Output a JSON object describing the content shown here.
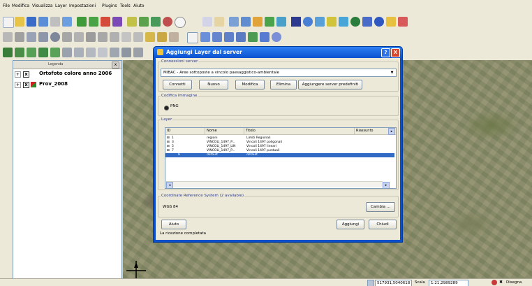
{
  "menu": [
    "File",
    "Modifica",
    "Visualizza",
    "Layer",
    "Impostazioni",
    "Plugins",
    "Tools",
    "Aiuto"
  ],
  "legend": {
    "title": "Legenda",
    "close": "x",
    "layers": [
      {
        "name": "Ortofoto colore anno 2006",
        "checked": "x"
      },
      {
        "name": "Prov_2008",
        "checked": "x"
      }
    ]
  },
  "dialog": {
    "title": "Aggiungi Layer dal server",
    "help": "?",
    "close": "X",
    "connections": {
      "group_title": "Connessioni server",
      "selected": "MIBAC - Aree sottoposte a vincolo paesaggistico-ambientale",
      "buttons": [
        "Connetti",
        "Nuovo",
        "Modifica",
        "Elimina",
        "Aggiungere server predefiniti"
      ]
    },
    "image_encoding": {
      "group_title": "Codifica immagine",
      "option": "PNG"
    },
    "layer": {
      "group_title": "Layer",
      "columns": [
        "ID",
        "Nome",
        "Titolo",
        "Riassunto"
      ],
      "rows": [
        {
          "id": "1",
          "name": "regioni",
          "title": "Limiti Regionali",
          "selected": false
        },
        {
          "id": "3",
          "name": "VINCOLI_1497_P...",
          "title": "Vincoli 1497 poligonali",
          "selected": false
        },
        {
          "id": "5",
          "name": "VINCOLI_1497_LIN",
          "title": "Vincoli 1497 lineari",
          "selected": false
        },
        {
          "id": "7",
          "name": "VINCOLI_1497_P...",
          "title": "Vincoli 1497 puntuali",
          "selected": false
        },
        {
          "id": "8",
          "name": "default",
          "title": "default",
          "selected": true
        }
      ]
    },
    "crs": {
      "group_title": "Coordinate Reference System (2 available)",
      "value": "WGS 84",
      "change_button": "Cambia ..."
    },
    "help_button": "Aiuto",
    "add_button": "Aggiungi",
    "close_button": "Chiudi",
    "status": "La ricezione completata"
  },
  "statusbar": {
    "coords": "517931,5040618",
    "scale_label": "Scala",
    "scale_value": "1:21,2989289",
    "render_label": "Disegna"
  },
  "colors": {
    "title_bar": "#0b52d0",
    "selection": "#316ac5",
    "toolbar_bg": "#ece9d8"
  }
}
